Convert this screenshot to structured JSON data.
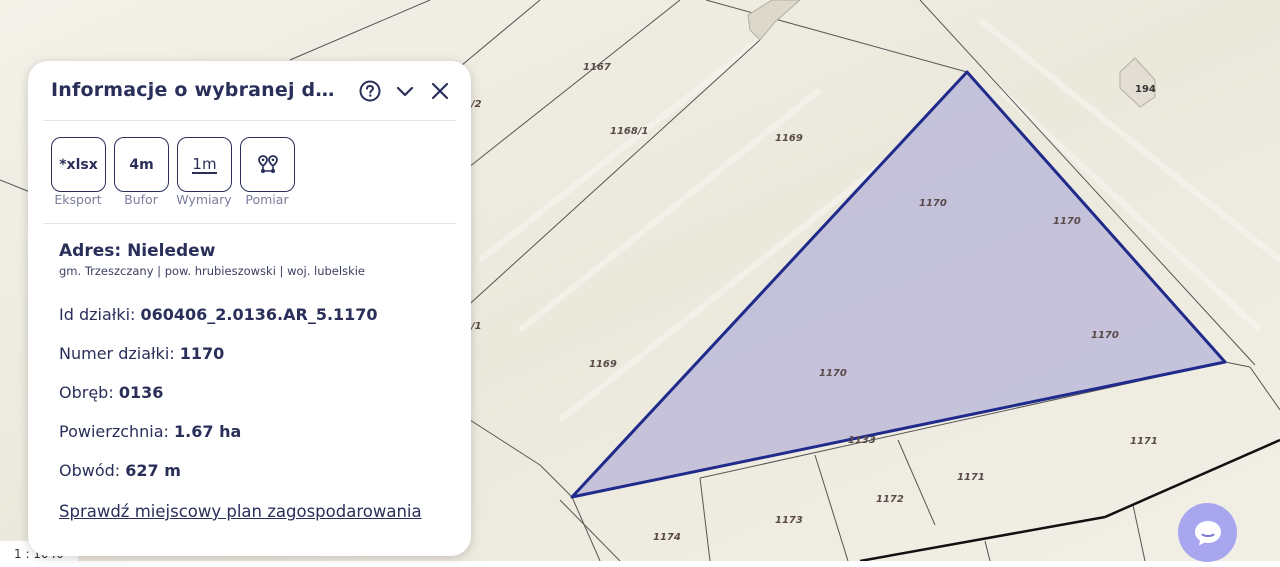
{
  "map": {
    "scale_text": "1 : 1040",
    "highlight_color": "#1f2a8a",
    "plot_labels": {
      "p1167": "1167",
      "p1168_1": "1168/1",
      "p1169_top": "1169",
      "p1169_left": "1169",
      "p1170_a": "1170",
      "p1170_b": "1170",
      "p1170_c": "1170",
      "p1170_d": "1170",
      "p1171_a": "1171",
      "p1171_b": "1171",
      "p1172": "1172",
      "p1173": "1173",
      "p1174": "1174",
      "p1133": "1133",
      "frag_2": "/2",
      "frag_1": "/1"
    },
    "building_label": "194"
  },
  "panel": {
    "title": "Informacje o wybranej dział...",
    "help_icon": "help-circle-icon",
    "collapse_icon": "chevron-down-icon",
    "close_icon": "close-icon",
    "tools": [
      {
        "icon_text": "*xlsx",
        "label": "Eksport"
      },
      {
        "icon_text": "4m",
        "label": "Bufor"
      },
      {
        "icon_text": "1m",
        "label": "Wymiary"
      },
      {
        "icon_text": "",
        "label": "Pomiar"
      }
    ],
    "address_title": "Adres: Nieledew",
    "address_sub": "gm. Trzeszczany | pow. hrubieszowski | woj. lubelskie",
    "fields": {
      "id_label": "Id działki: ",
      "id_value": "060406_2.0136.AR_5.1170",
      "number_label": "Numer działki: ",
      "number_value": "1170",
      "precinct_label": "Obręb: ",
      "precinct_value": "0136",
      "area_label": "Powierzchnia: ",
      "area_value": "1.67 ha",
      "perimeter_label": "Obwód: ",
      "perimeter_value": "627 m"
    },
    "plan_link": "Sprawdź miejscowy plan zagospodarowania"
  },
  "chat": {
    "icon": "chat-bubble-icon"
  }
}
